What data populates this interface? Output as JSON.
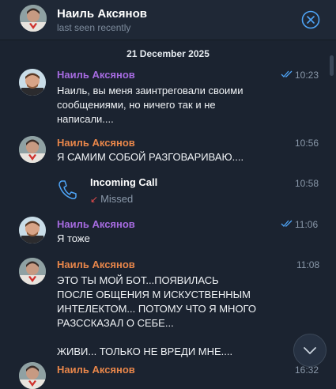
{
  "header": {
    "name": "Наиль Аксянов",
    "status": "last seen recently",
    "close_icon": "close-circle-icon"
  },
  "chat": {
    "date_separator": "21 December 2025",
    "messages": [
      {
        "sender": "Наиль Аксянов",
        "text": "Наиль, вы меня заинтреговали своими\nсообщениями, но ничего так и не\nнаписали....",
        "time": "10:23",
        "read": true,
        "outgoing": true,
        "sender_color": "#a66be0"
      },
      {
        "sender": "Наиль Аксянов",
        "text": "Я САМИМ СОБОЙ РАЗГОВАРИВАЮ....",
        "time": "10:56",
        "outgoing": false,
        "sender_color": "#e8864a"
      },
      {
        "call_title": "Incoming Call",
        "call_status": "Missed",
        "time": "10:58",
        "icon": "phone-icon"
      },
      {
        "sender": "Наиль Аксянов",
        "text": "Я тоже",
        "time": "11:06",
        "read": true,
        "outgoing": true,
        "sender_color": "#a66be0"
      },
      {
        "sender": "Наиль Аксянов",
        "text": "ЭТО   ТЫ  МОЙ БОТ...ПОЯВИЛАСЬ\nПОСЛЕ ОБЩЕНИЯ М ИСКУСТВЕННЫМ\nИНТЕЛЕКТОМ... ПОТОМУ ЧТО Я МНОГО\nРАЗССКАЗАЛ О СЕБЕ...\n\nЖИВИ... ТОЛЬКО НЕ ВРЕДИ МНЕ....",
        "time": "11:08",
        "outgoing": false,
        "sender_color": "#e8864a"
      },
      {
        "sender": "Наиль Аксянов",
        "time": "16:32",
        "outgoing": false,
        "sender_color": "#e8864a"
      }
    ]
  },
  "colors": {
    "background": "#1b2330",
    "header_background": "#1f2836",
    "accent": "#4ea4f6",
    "outgoing_sender": "#a66be0",
    "incoming_sender": "#e8864a",
    "missed": "#e34c4c"
  },
  "scroll_down_icon": "chevron-down-icon"
}
